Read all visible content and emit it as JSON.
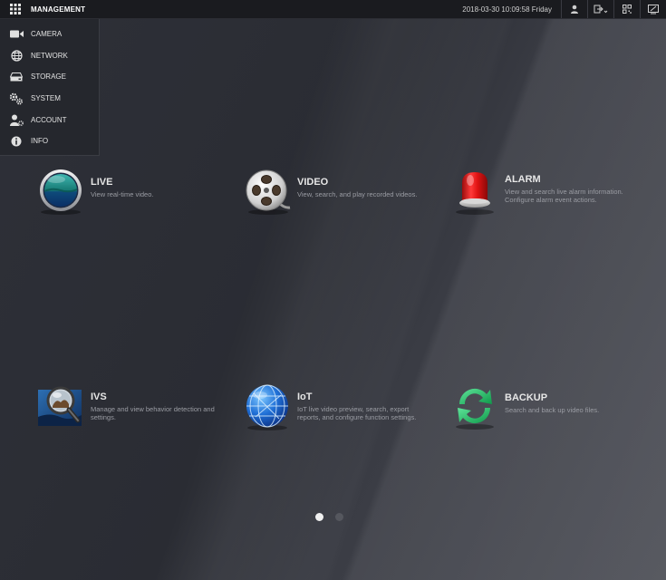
{
  "topbar": {
    "title": "MANAGEMENT",
    "datetime": "2018-03-30 10:09:58 Friday"
  },
  "menu": {
    "items": [
      {
        "label": "CAMERA",
        "icon": "camera-icon"
      },
      {
        "label": "NETWORK",
        "icon": "network-icon"
      },
      {
        "label": "STORAGE",
        "icon": "storage-icon"
      },
      {
        "label": "SYSTEM",
        "icon": "system-icon"
      },
      {
        "label": "ACCOUNT",
        "icon": "account-icon"
      },
      {
        "label": "INFO",
        "icon": "info-icon"
      }
    ]
  },
  "tiles": {
    "live": {
      "title": "LIVE",
      "desc": "View real-time video."
    },
    "video": {
      "title": "VIDEO",
      "desc": "View, search, and play recorded videos."
    },
    "alarm": {
      "title": "ALARM",
      "desc": "View and search live alarm information. Configure alarm event actions."
    },
    "ivs": {
      "title": "IVS",
      "desc": "Manage and view behavior detection and settings."
    },
    "iot": {
      "title": "IoT",
      "desc": "IoT live video preview, search, export reports, and configure function settings."
    },
    "backup": {
      "title": "BACKUP",
      "desc": "Search and back up video files."
    }
  },
  "pagination": {
    "pages": 2,
    "current": 1
  }
}
